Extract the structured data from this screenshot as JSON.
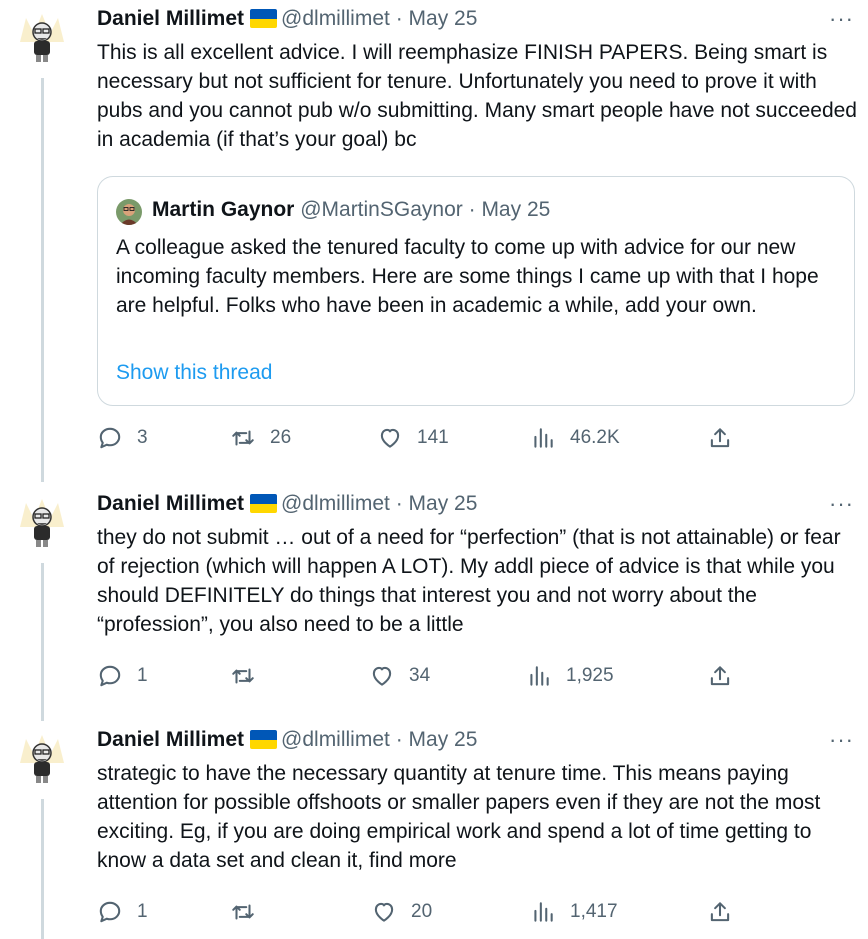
{
  "tweets": [
    {
      "name": "Daniel Millimet",
      "handle": "@dlmillimet",
      "dot": "·",
      "date": "May 25",
      "more": "···",
      "text": "This is all excellent advice. I will reemphasize FINISH PAPERS. Being smart is necessary but not sufficient for tenure. Unfortunately you need to prove it with pubs and you cannot pub w/o submitting. Many smart people have not succeeded in academia (if that’s your goal) bc",
      "quote": {
        "name": "Martin Gaynor",
        "handle": "@MartinSGaynor",
        "dot": "·",
        "date": "May 25",
        "text": "A colleague asked the tenured faculty to come up with advice for our new incoming faculty members. Here are some things I came up with that I hope are helpful. Folks who have been in academic a while, add your own.",
        "show_thread": "Show this thread"
      },
      "stats": {
        "replies": "3",
        "retweets": "26",
        "likes": "141",
        "views": "46.2K"
      }
    },
    {
      "name": "Daniel Millimet",
      "handle": "@dlmillimet",
      "dot": "·",
      "date": "May 25",
      "more": "···",
      "text": "they do not submit … out of a need for “perfection” (that is not attainable) or fear of rejection (which will happen A LOT). My addl piece of advice is that while you should DEFINITELY do things that interest you and not worry about the “profession”, you also need to be a little",
      "stats": {
        "replies": "1",
        "retweets": "",
        "likes": "34",
        "views": "1,925"
      }
    },
    {
      "name": "Daniel Millimet",
      "handle": "@dlmillimet",
      "dot": "·",
      "date": "May 25",
      "more": "···",
      "text": "strategic to have the necessary quantity at tenure time. This means paying attention for possible offshoots or smaller papers even if they are not the most exciting. Eg, if you are doing empirical work and spend a lot of time getting to know a data set and clean it, find more",
      "stats": {
        "replies": "1",
        "retweets": "",
        "likes": "20",
        "views": "1,417"
      }
    }
  ],
  "colors": {
    "accent": "#1d9bf0",
    "muted": "#536471",
    "border": "#cfd9de",
    "flag_blue": "#0057b7",
    "flag_yellow": "#ffd700"
  },
  "icons": [
    "reply-icon",
    "retweet-icon",
    "like-icon",
    "views-icon",
    "share-icon",
    "more-icon",
    "ukraine-flag-icon"
  ]
}
